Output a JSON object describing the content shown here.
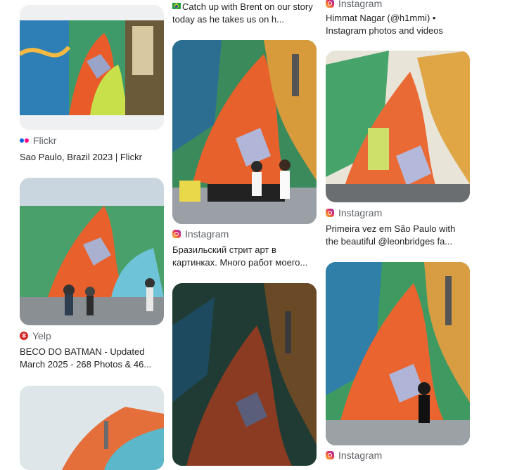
{
  "colors": {
    "text": "#1f1f1f",
    "source": "#5f6368",
    "background": "#ffffff"
  },
  "columns": [
    {
      "cards": [
        {
          "source": "Flickr",
          "source_icon": "flickr-icon",
          "title": "Sao Paulo, Brazil 2023 | Flickr"
        },
        {
          "source": "Yelp",
          "source_icon": "yelp-icon",
          "title": "BECO DO BATMAN - Updated March 2025 - 268 Photos & 46..."
        },
        {
          "source": "",
          "source_icon": "",
          "title": ""
        }
      ]
    },
    {
      "cards": [
        {
          "source": "",
          "source_icon": "brazil-flag-icon",
          "title": "Catch up with Brent on our story today as he takes us on h..."
        },
        {
          "source": "Instagram",
          "source_icon": "instagram-icon",
          "title": "Бразильский стрит арт в картинках. Много работ моего..."
        },
        {
          "source": "",
          "source_icon": "",
          "title": ""
        }
      ]
    },
    {
      "cards": [
        {
          "source": "Instagram",
          "source_icon": "instagram-icon",
          "title": "Himmat Nagar (@h1mmi) • Instagram photos and videos"
        },
        {
          "source": "Instagram",
          "source_icon": "instagram-icon",
          "title": "Primeira vez em São Paulo with the beautiful @leonbridges fa..."
        },
        {
          "source": "Instagram",
          "source_icon": "instagram-icon",
          "title": ""
        }
      ]
    }
  ]
}
